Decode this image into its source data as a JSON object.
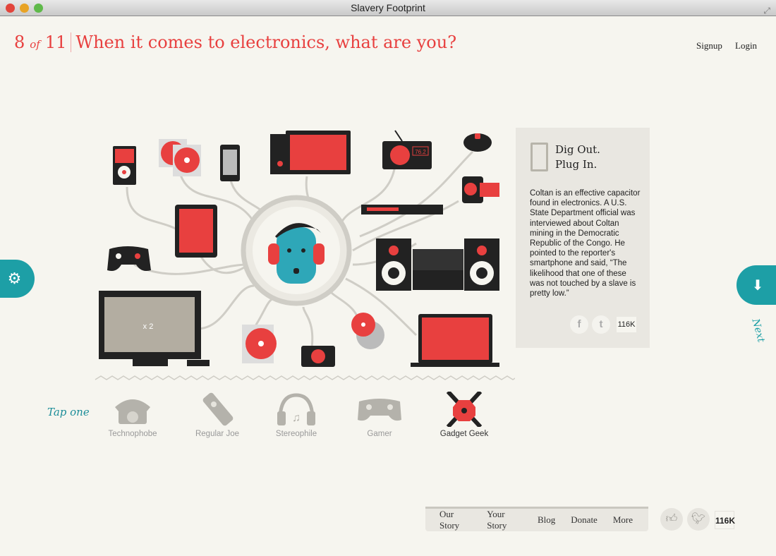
{
  "window": {
    "title": "Slavery Footprint"
  },
  "header": {
    "step": "8",
    "of": "of",
    "total": "11",
    "question": "When it comes to electronics, what are you?",
    "signup": "Signup",
    "login": "Login"
  },
  "illustration": {
    "tv_multiplier": "x 2",
    "radio_display": "76.2"
  },
  "side_tabs": {
    "settings_icon": "gear-icon",
    "next_icon": "arrow-down-icon",
    "next_label": "Next"
  },
  "panel": {
    "title_line1": "Dig Out.",
    "title_line2": "Plug In.",
    "body": "Coltan is an effective capacitor found in electronics. A U.S. State Department official was interviewed about Coltan mining in the Democratic Republic of the Congo. He pointed to the reporter's smartphone and said, “The likelihood that one of these was not touched by a slave is pretty low.”",
    "facebook": "f",
    "twitter": "t",
    "count": "116K"
  },
  "choices": {
    "prompt": "Tap one",
    "options": [
      {
        "label": "Technophobe"
      },
      {
        "label": "Regular Joe"
      },
      {
        "label": "Stereophile"
      },
      {
        "label": "Gamer"
      },
      {
        "label": "Gadget Geek",
        "selected": true
      }
    ]
  },
  "footer": {
    "nav": [
      "Our Story",
      "Your Story",
      "Blog",
      "Donate",
      "More"
    ],
    "like_icon": "thumbs-up-icon",
    "twitter_icon": "bird-icon",
    "count": "116K"
  },
  "colors": {
    "accent_red": "#e8403f",
    "teal": "#1d9fa6",
    "panel": "#e9e7e1",
    "background": "#f6f5ef"
  }
}
